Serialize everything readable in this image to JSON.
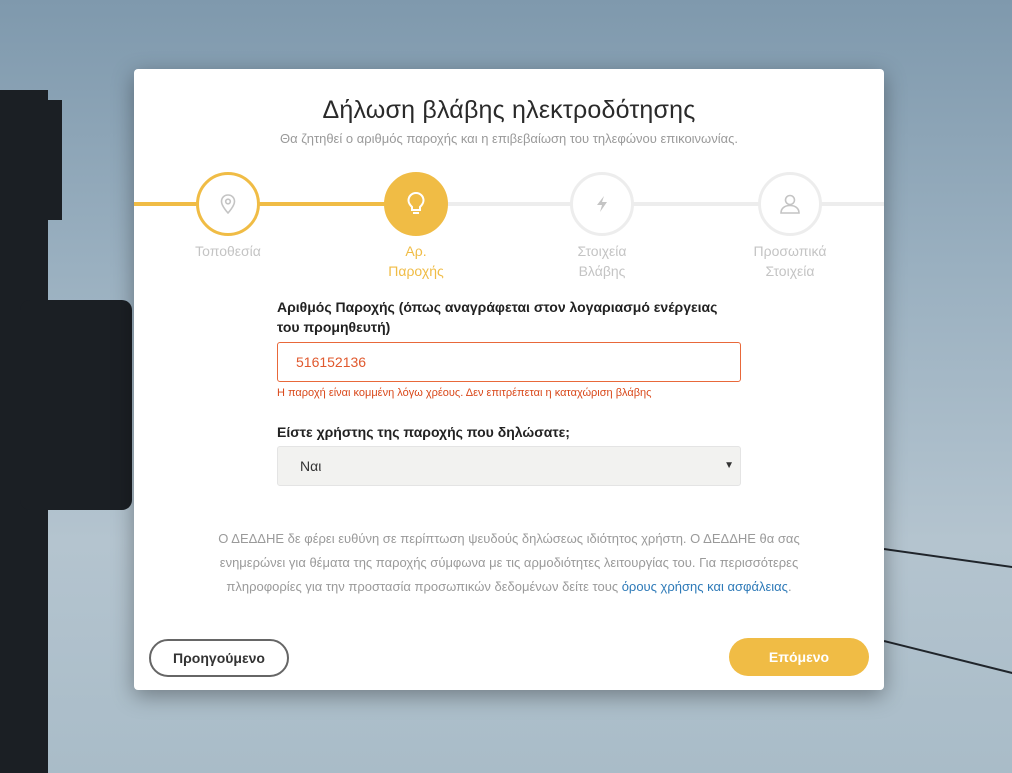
{
  "form": {
    "title": "Δήλωση βλάβης ηλεκτροδότησης",
    "subtitle": "Θα ζητηθεί ο αριθμός παροχής και η επιβεβαίωση του τηλεφώνου επικοινωνίας."
  },
  "steps": [
    {
      "line1": "Τοποθεσία",
      "line2": "",
      "state": "done",
      "icon": "location-pin-icon"
    },
    {
      "line1": "Αρ.",
      "line2": "Παροχής",
      "state": "active",
      "icon": "lightbulb-icon"
    },
    {
      "line1": "Στοιχεία",
      "line2": "Βλάβης",
      "state": "todo",
      "icon": "lightning-icon"
    },
    {
      "line1": "Προσωπικά",
      "line2": "Στοιχεία",
      "state": "todo",
      "icon": "user-icon"
    }
  ],
  "supply_number": {
    "label_line1": "Αριθμός Παροχής (όπως αναγράφεται στον λογαριασμό ενέργειας",
    "label_line2": "του προμηθευτή)",
    "value": "516152136",
    "error": "Η παροχή είναι κομμένη λόγω χρέους. Δεν επιτρέπεται η καταχώριση βλάβης"
  },
  "is_user": {
    "label": "Είστε χρήστης της παροχής που δηλώσατε;",
    "selected": "Ναι"
  },
  "disclaimer": {
    "text": "Ο ΔΕΔΔΗΕ δε φέρει ευθύνη σε περίπτωση ψευδούς δηλώσεως ιδιότητος χρήστη. Ο ΔΕΔΔΗΕ θα σας ενημερώνει για θέματα της παροχής σύμφωνα με τις αρμοδιότητες λειτουργίας του. Για περισσότερες πληροφορίες για την προστασία προσωπικών δεδομένων δείτε τους ",
    "link": "όρους χρήσης και ασφάλειας",
    "end": "."
  },
  "buttons": {
    "prev": "Προηγούμενο",
    "next": "Επόμενο"
  },
  "colors": {
    "accent": "#f0bc45",
    "error": "#d9481a",
    "link": "#2e7ab8"
  }
}
